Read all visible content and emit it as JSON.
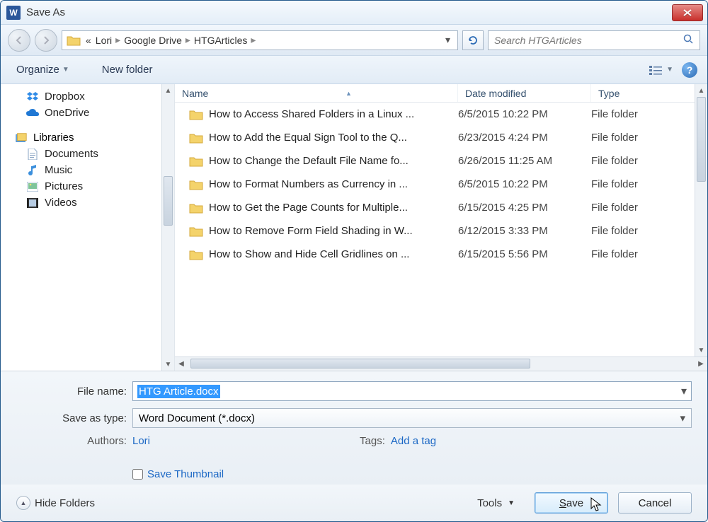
{
  "title": "Save As",
  "breadcrumb": {
    "chev": "«",
    "seg1": "Lori",
    "seg2": "Google Drive",
    "seg3": "HTGArticles"
  },
  "search_placeholder": "Search HTGArticles",
  "toolbar": {
    "organize": "Organize",
    "newfolder": "New folder"
  },
  "sidebar": {
    "items": [
      {
        "label": "Dropbox",
        "icon": "dropbox"
      },
      {
        "label": "OneDrive",
        "icon": "onedrive"
      }
    ],
    "libraries_label": "Libraries",
    "libraries": [
      {
        "label": "Documents",
        "icon": "doc"
      },
      {
        "label": "Music",
        "icon": "music"
      },
      {
        "label": "Pictures",
        "icon": "pic"
      },
      {
        "label": "Videos",
        "icon": "vid"
      }
    ]
  },
  "columns": {
    "name": "Name",
    "date": "Date modified",
    "type": "Type"
  },
  "files": [
    {
      "name": "How to Access Shared Folders in a Linux ...",
      "date": "6/5/2015 10:22 PM",
      "type": "File folder"
    },
    {
      "name": "How to Add the Equal Sign Tool to the Q...",
      "date": "6/23/2015 4:24 PM",
      "type": "File folder"
    },
    {
      "name": "How to Change the Default File Name fo...",
      "date": "6/26/2015 11:25 AM",
      "type": "File folder"
    },
    {
      "name": "How to Format Numbers as Currency in ...",
      "date": "6/5/2015 10:22 PM",
      "type": "File folder"
    },
    {
      "name": "How to Get the Page Counts for Multiple...",
      "date": "6/15/2015 4:25 PM",
      "type": "File folder"
    },
    {
      "name": "How to Remove Form Field Shading in W...",
      "date": "6/12/2015 3:33 PM",
      "type": "File folder"
    },
    {
      "name": "How to Show and Hide Cell Gridlines on ...",
      "date": "6/15/2015 5:56 PM",
      "type": "File folder"
    }
  ],
  "form": {
    "filename_label": "File name:",
    "filename_value": "HTG Article.docx",
    "savetype_label": "Save as type:",
    "savetype_value": "Word Document (*.docx)",
    "authors_label": "Authors:",
    "authors_value": "Lori",
    "tags_label": "Tags:",
    "tags_value": "Add a tag",
    "thumb_label": "Save Thumbnail"
  },
  "footer": {
    "hide_folders": "Hide Folders",
    "tools": "Tools",
    "save": "Save",
    "cancel": "Cancel"
  }
}
